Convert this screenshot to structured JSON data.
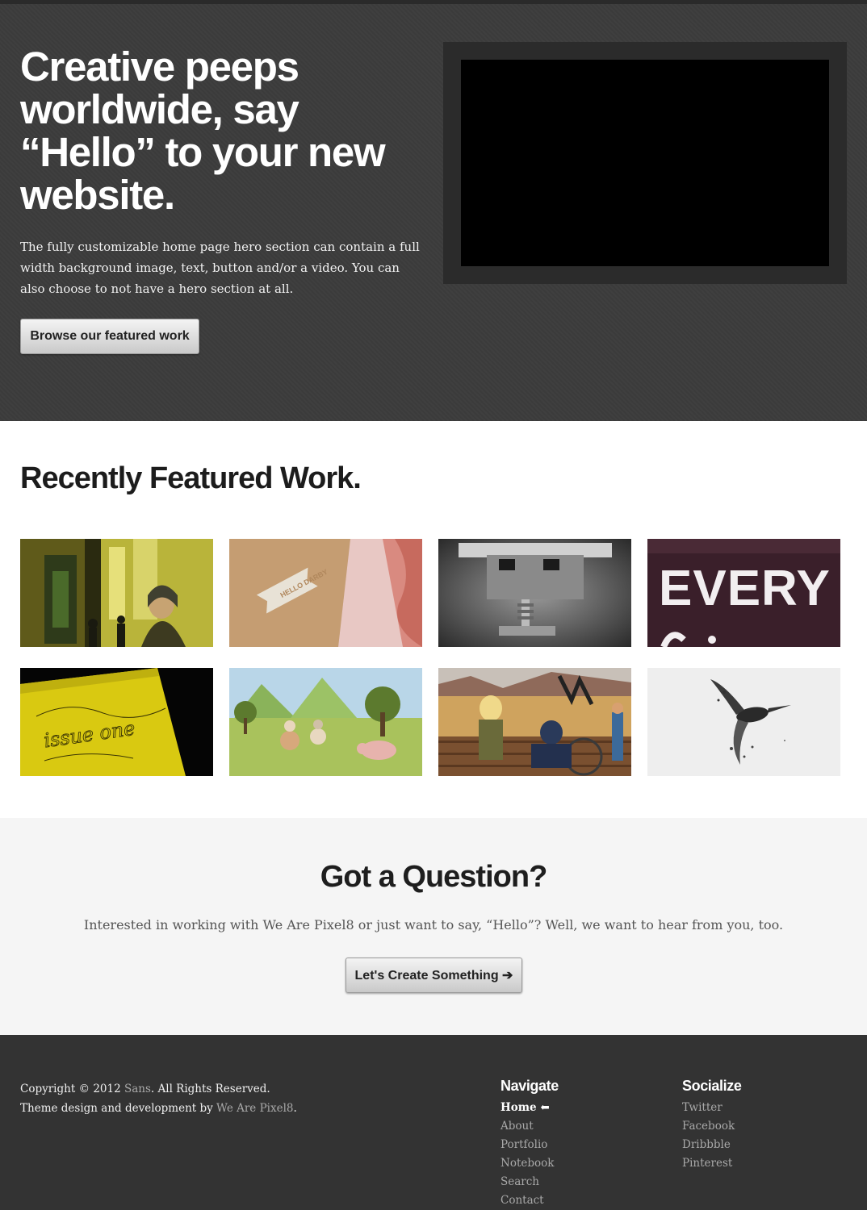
{
  "hero": {
    "title": "Creative peeps\nworldwide, say\n“Hello” to your new\nwebsite.",
    "description": "The fully customizable home page hero section can contain a full width background image, text, button and/or a video. You can also choose to not have a hero section at all.",
    "button_label": "Browse our featured work"
  },
  "featured": {
    "title": "Recently Featured Work.",
    "thumbnail_text": {
      "hello_card": "HELLO DARBY",
      "every_sign": "EVERY",
      "issue_one": "issue one"
    }
  },
  "question": {
    "title": "Got a Question?",
    "text": "Interested in working with We Are Pixel8 or just want to say, “Hello”? Well, we want to hear from you, too.",
    "button_label": "Let's Create Something ➔"
  },
  "footer": {
    "copyright_prefix": "Copyright © 2012 ",
    "site_name": "Sans",
    "copyright_suffix": ". All Rights Reserved.",
    "credit_prefix": "Theme design and development by ",
    "credit_name": "We Are Pixel8",
    "credit_suffix": ".",
    "navigate": {
      "heading": "Navigate",
      "items": [
        "Home ⬅",
        "About",
        "Portfolio",
        "Notebook",
        "Search",
        "Contact"
      ]
    },
    "socialize": {
      "heading": "Socialize",
      "items": [
        "Twitter",
        "Facebook",
        "Dribbble",
        "Pinterest"
      ]
    }
  },
  "colors": {
    "hero_bg": "#3c3c3c",
    "question_bg": "#f5f5f5",
    "footer_bg": "#333333",
    "link_muted": "#a9a9a9"
  }
}
